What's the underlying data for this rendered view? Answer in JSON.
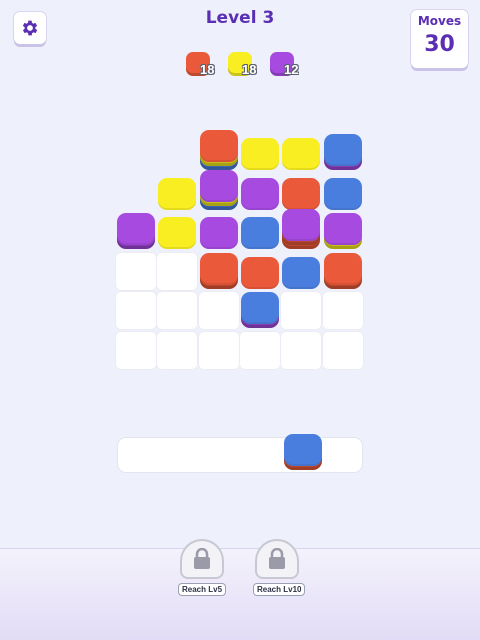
{
  "header": {
    "level_title": "Level 3",
    "moves_label": "Moves",
    "moves_value": "30"
  },
  "colors": {
    "red": "#ea5a3a",
    "yellow": "#f8ee22",
    "purple": "#a64ae0",
    "blue": "#4a7ede"
  },
  "goals": [
    {
      "color": "red",
      "count": "18"
    },
    {
      "color": "yellow",
      "count": "18"
    },
    {
      "color": "purple",
      "count": "12"
    }
  ],
  "board": {
    "columns": 6,
    "rows": 6,
    "stacks": [
      {
        "col": 2,
        "row": 0,
        "layers": [
          "blue",
          "yellow",
          "red"
        ]
      },
      {
        "col": 3,
        "row": 0,
        "layers": [
          "yellow"
        ]
      },
      {
        "col": 4,
        "row": 0,
        "layers": [
          "yellow"
        ]
      },
      {
        "col": 5,
        "row": 0,
        "layers": [
          "purple",
          "blue"
        ]
      },
      {
        "col": 1,
        "row": 1,
        "layers": [
          "yellow"
        ]
      },
      {
        "col": 2,
        "row": 1,
        "layers": [
          "blue",
          "yellow",
          "purple"
        ]
      },
      {
        "col": 3,
        "row": 1,
        "layers": [
          "purple"
        ]
      },
      {
        "col": 4,
        "row": 1,
        "layers": [
          "red"
        ]
      },
      {
        "col": 5,
        "row": 1,
        "layers": [
          "blue"
        ]
      },
      {
        "col": 0,
        "row": 2,
        "layers": [
          "purple",
          "purple"
        ]
      },
      {
        "col": 1,
        "row": 2,
        "layers": [
          "yellow"
        ]
      },
      {
        "col": 2,
        "row": 2,
        "layers": [
          "purple"
        ]
      },
      {
        "col": 3,
        "row": 2,
        "layers": [
          "blue"
        ]
      },
      {
        "col": 4,
        "row": 2,
        "layers": [
          "red",
          "red",
          "purple"
        ]
      },
      {
        "col": 5,
        "row": 2,
        "layers": [
          "yellow",
          "purple"
        ]
      },
      {
        "col": 2,
        "row": 3,
        "layers": [
          "red",
          "red"
        ]
      },
      {
        "col": 3,
        "row": 3,
        "layers": [
          "red"
        ]
      },
      {
        "col": 4,
        "row": 3,
        "layers": [
          "blue"
        ]
      },
      {
        "col": 5,
        "row": 3,
        "layers": [
          "red",
          "red"
        ]
      },
      {
        "col": 3,
        "row": 4,
        "layers": [
          "purple",
          "blue"
        ]
      }
    ],
    "empty_cells": [
      {
        "col": 0,
        "row": 3
      },
      {
        "col": 1,
        "row": 3
      },
      {
        "col": 0,
        "row": 4
      },
      {
        "col": 1,
        "row": 4
      },
      {
        "col": 2,
        "row": 4
      },
      {
        "col": 4,
        "row": 4
      },
      {
        "col": 5,
        "row": 4
      },
      {
        "col": 0,
        "row": 5
      },
      {
        "col": 1,
        "row": 5
      },
      {
        "col": 2,
        "row": 5
      },
      {
        "col": 3,
        "row": 5
      },
      {
        "col": 4,
        "row": 5
      },
      {
        "col": 5,
        "row": 5
      }
    ]
  },
  "tray": {
    "slots": 6,
    "stacks": [
      {
        "slot": 4,
        "layers": [
          "red",
          "blue"
        ]
      }
    ]
  },
  "boosters": [
    {
      "label": "Reach Lv5",
      "icon": "lock-icon",
      "locked": true
    },
    {
      "label": "Reach Lv10",
      "icon": "lock-icon",
      "locked": true
    }
  ]
}
